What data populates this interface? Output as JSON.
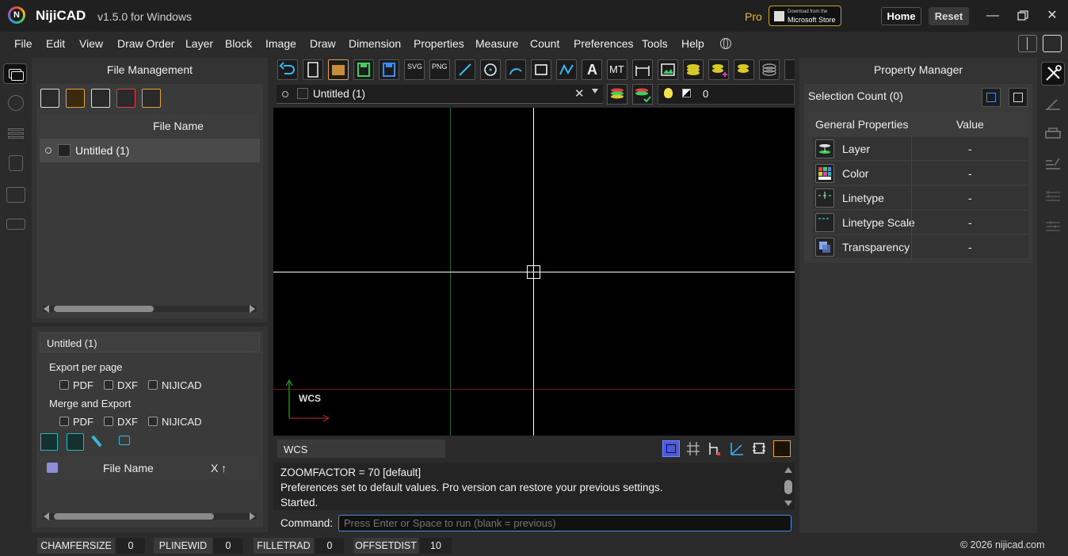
{
  "titlebar": {
    "app_name": "NijiCAD",
    "version": "v1.5.0 for Windows",
    "pro_label": "Pro",
    "store_small": "Download from the",
    "store_big": "Microsoft Store",
    "home_label": "Home",
    "reset_label": "Reset"
  },
  "menu": [
    "File",
    "Edit",
    "View",
    "Draw Order",
    "Layer",
    "Block",
    "Image",
    "Draw",
    "Dimension",
    "Properties",
    "Measure",
    "Count",
    "Preferences",
    "Tools",
    "Help"
  ],
  "file_management": {
    "title": "File Management",
    "column_header": "File Name",
    "files": [
      "Untitled (1)"
    ]
  },
  "export": {
    "document_name": "Untitled (1)",
    "per_page_label": "Export per page",
    "merge_label": "Merge and Export",
    "options": [
      "PDF",
      "DXF",
      "NIJICAD"
    ],
    "table_col_name": "File Name",
    "table_col_x": "X ↑"
  },
  "toolbar": {
    "doc_tab": "Untitled (1)",
    "layer_value": "0",
    "icon_texts": {
      "svg": "SVG",
      "png": "PNG",
      "text": "A",
      "mtext": "MT"
    }
  },
  "canvas": {
    "ucs_label": "WCS"
  },
  "command": {
    "coord_system": "WCS",
    "history": [
      "ZOOMFACTOR = 70 [default]",
      "Preferences set to default values. Pro version can restore your previous settings.",
      "Started."
    ],
    "prompt_label": "Command:",
    "placeholder": "Press Enter or Space to run (blank = previous)"
  },
  "property_manager": {
    "title": "Property Manager",
    "selection_count": "Selection Count (0)",
    "col_general": "General Properties",
    "col_value": "Value",
    "rows": [
      {
        "label": "Layer",
        "value": "-"
      },
      {
        "label": "Color",
        "value": "-"
      },
      {
        "label": "Linetype",
        "value": "-"
      },
      {
        "label": "Linetype Scale",
        "value": "-"
      },
      {
        "label": "Transparency",
        "value": "-"
      }
    ]
  },
  "statusbar": {
    "vars": [
      {
        "name": "CHAMFERSIZE",
        "value": "0"
      },
      {
        "name": "PLINEWID",
        "value": "0"
      },
      {
        "name": "FILLETRAD",
        "value": "0"
      },
      {
        "name": "OFFSETDIST",
        "value": "10"
      }
    ],
    "copyright": "© 2026 nijicad.com"
  },
  "colors": {
    "accent_blue": "#4a90d9",
    "pro_gold": "#f0b429",
    "canvas_bg": "#000000",
    "axis_green": "#1f7a1f",
    "axis_red": "#7a1f1f"
  }
}
